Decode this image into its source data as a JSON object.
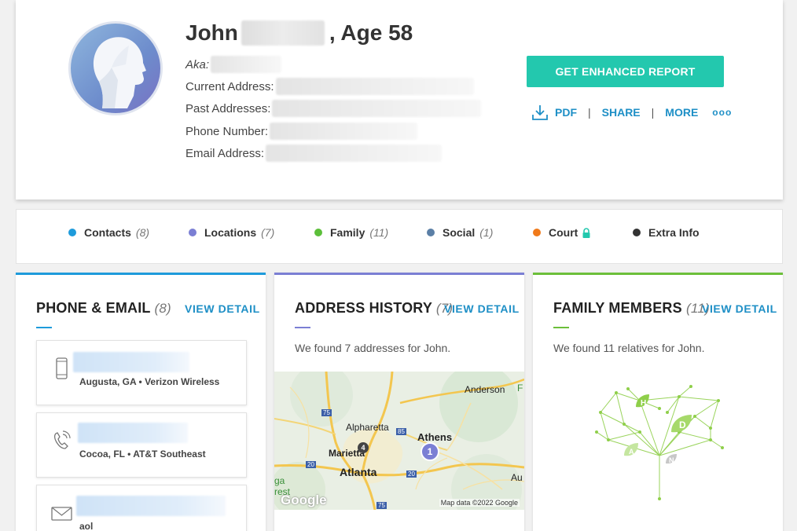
{
  "profile": {
    "first_name": "John",
    "age_text": ", Age 58",
    "fields": [
      {
        "label": "Aka:"
      },
      {
        "label": "Current Address:"
      },
      {
        "label": "Past Addresses:"
      },
      {
        "label": "Phone Number:"
      },
      {
        "label": "Email Address:"
      }
    ]
  },
  "report": {
    "button_label": "GET ENHANCED REPORT",
    "pdf_label": "PDF",
    "share_label": "SHARE",
    "more_label": "MORE",
    "separator": "|",
    "dots": "ooo"
  },
  "filters": [
    {
      "label": "Contacts",
      "count": "(8)",
      "color": "#1e9bdb"
    },
    {
      "label": "Locations",
      "count": "(7)",
      "color": "#7b7fd4"
    },
    {
      "label": "Family",
      "count": "(11)",
      "color": "#5cbf3a"
    },
    {
      "label": "Social",
      "count": "(1)",
      "color": "#5b7fa6"
    },
    {
      "label": "Court",
      "count": "",
      "color": "#f07a1a"
    },
    {
      "label": "Extra Info",
      "count": "",
      "color": "#333333"
    }
  ],
  "panels": {
    "phone_email": {
      "title": "PHONE & EMAIL",
      "count": "(8)",
      "link": "VIEW DETAIL",
      "accent": "#1e9bdb"
    },
    "address_history": {
      "title": "ADDRESS HISTORY",
      "count": "(7)",
      "link": "VIEW DETAIL",
      "accent": "#7b7fd4",
      "text": "We found 7 addresses for John."
    },
    "family_members": {
      "title": "FAMILY MEMBERS",
      "count": "(11)",
      "link": "VIEW DETAIL",
      "accent": "#6cbf3a",
      "text": "We found 11 relatives for John."
    }
  },
  "contacts": [
    {
      "icon": "mobile-phone-icon",
      "sub": "Augusta, GA • Verizon Wireless"
    },
    {
      "icon": "landline-phone-icon",
      "sub": "Cocoa, FL • AT&T Southeast"
    },
    {
      "icon": "envelope-icon",
      "sub": "aol"
    }
  ],
  "map": {
    "labels": [
      "Anderson",
      "Alpharetta",
      "Athens",
      "Marietta",
      "Atlanta",
      "Au",
      "F",
      "ga",
      "rest"
    ],
    "highways": [
      "75",
      "85",
      "20",
      "20",
      "75"
    ],
    "pins": [
      {
        "label": "4"
      },
      {
        "label": "1"
      }
    ],
    "google": "Google",
    "credit": "Map data ©2022 Google"
  },
  "family_tree_letters": [
    "H",
    "D",
    "A",
    "N"
  ]
}
